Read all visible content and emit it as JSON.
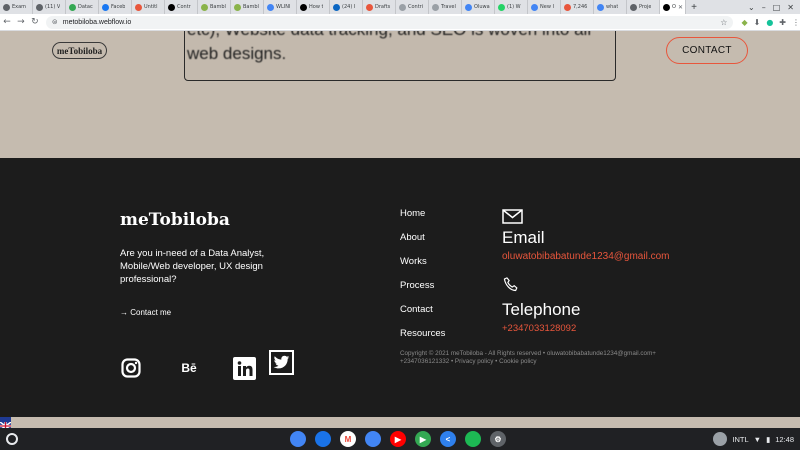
{
  "browser": {
    "tabs": [
      {
        "label": "Exam",
        "color": "#5f6368"
      },
      {
        "label": "(11) V",
        "color": "#5f6368"
      },
      {
        "label": "Datac",
        "color": "#34a853"
      },
      {
        "label": "Faceb",
        "color": "#1877f2"
      },
      {
        "label": "Untitl",
        "color": "#e8563c"
      },
      {
        "label": "Contr",
        "color": "#000000"
      },
      {
        "label": "Bambl",
        "color": "#8ab34a"
      },
      {
        "label": "Bambl",
        "color": "#8ab34a"
      },
      {
        "label": "WLINI",
        "color": "#4285f4"
      },
      {
        "label": "How t",
        "color": "#000000"
      },
      {
        "label": "(24) I",
        "color": "#0a66c2"
      },
      {
        "label": "Drafts",
        "color": "#e8563c"
      },
      {
        "label": "Contri",
        "color": "#9aa0a6"
      },
      {
        "label": "Travel",
        "color": "#9aa0a6"
      },
      {
        "label": "Oluwa",
        "color": "#4285f4"
      },
      {
        "label": "(1) W",
        "color": "#25d366"
      },
      {
        "label": "New I",
        "color": "#4285f4"
      },
      {
        "label": "7,246",
        "color": "#e8563c"
      },
      {
        "label": "what",
        "color": "#4285f4"
      },
      {
        "label": "Proje",
        "color": "#5f6368"
      },
      {
        "label": "Ol",
        "color": "#000000"
      }
    ],
    "url": "metobiloba.webflow.io"
  },
  "page": {
    "card_text": "etc), Website data tracking, and SEO is woven into all web designs.",
    "logo": "meTobiloba",
    "contact_button": "CONTACT"
  },
  "footer": {
    "brand": "meTobiloba",
    "tagline": "Are you in-need of a  Data Analyst, Mobile/Web developer, UX design professional?",
    "contact_link": "→ Contact me",
    "nav": [
      "Home",
      "About",
      "Works",
      "Process",
      "Contact",
      "Resources"
    ],
    "email_heading": "Email",
    "email_value": "oluwatobibabatunde1234@gmail.com",
    "tel_heading": "Telephone",
    "tel_value": "+2347033128092",
    "copyright": "Copyright © 2021 meTobiloba - All Rights reserved • oluwatobibabatunde1234@gmail.com+ +2347036121332 • Privacy policy • Cookie policy",
    "behance_label": "Bē"
  },
  "shelf": {
    "apps": [
      {
        "name": "chrome",
        "color": "#4285f4",
        "glyph": ""
      },
      {
        "name": "files",
        "color": "#1a73e8",
        "glyph": ""
      },
      {
        "name": "gmail",
        "color": "#ffffff",
        "glyph": "M"
      },
      {
        "name": "docs",
        "color": "#4285f4",
        "glyph": ""
      },
      {
        "name": "youtube",
        "color": "#ff0000",
        "glyph": "▶"
      },
      {
        "name": "play-store",
        "color": "#34a853",
        "glyph": "▶"
      },
      {
        "name": "vscode",
        "color": "#2f80ed",
        "glyph": "<"
      },
      {
        "name": "spotify",
        "color": "#1db954",
        "glyph": ""
      },
      {
        "name": "settings",
        "color": "#5f6368",
        "glyph": "⚙"
      }
    ],
    "locale": "INTL",
    "time": "12:48"
  }
}
